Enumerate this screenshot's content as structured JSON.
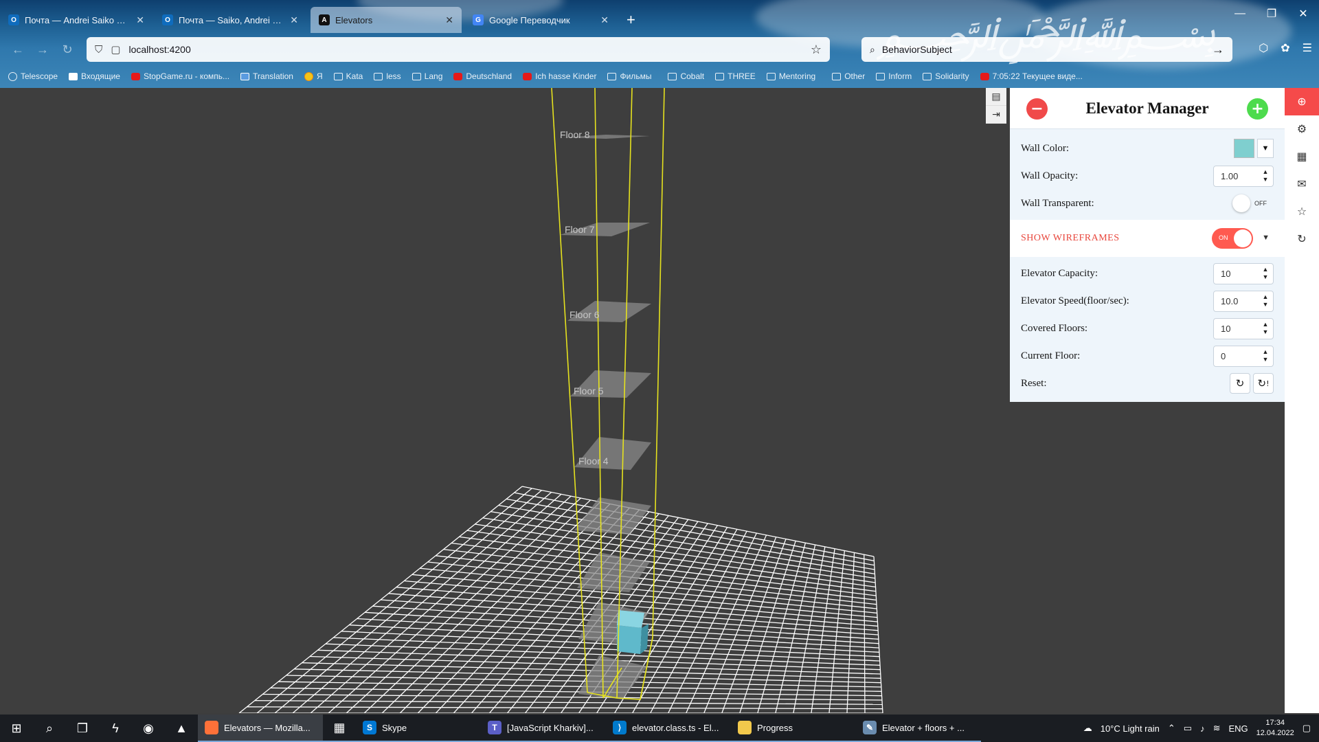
{
  "browser": {
    "tabs": [
      {
        "label": "Почта — Andrei Saiko — Outlo",
        "icon": "outlook-icon",
        "color": "#0f6cbd"
      },
      {
        "label": "Почта — Saiko, Andrei — Outlo",
        "icon": "outlook-icon",
        "color": "#0f6cbd"
      },
      {
        "label": "Elevators",
        "icon": "angular-icon",
        "color": "#111111"
      },
      {
        "label": "Google Переводчик",
        "icon": "translate-icon",
        "color": "#4285f4"
      }
    ],
    "url": "localhost:4200",
    "search": "BehaviorSubject",
    "bookmarks": [
      {
        "label": "Telescope",
        "icon": "globe"
      },
      {
        "label": "Входящие",
        "icon": "gm"
      },
      {
        "label": "StopGame.ru - компь...",
        "icon": "red"
      },
      {
        "label": "Translation",
        "icon": "tr"
      },
      {
        "label": "Я",
        "icon": "ya"
      },
      {
        "label": "Kata",
        "icon": "folder"
      },
      {
        "label": "less",
        "icon": "folder"
      },
      {
        "label": "Lang",
        "icon": "folder"
      },
      {
        "label": "Deutschland",
        "icon": "red"
      },
      {
        "label": "Ich hasse Kinder",
        "icon": "red"
      },
      {
        "label": "Фильмы",
        "icon": "folder"
      },
      {
        "label": "Cobalt",
        "icon": "folder"
      },
      {
        "label": "THREE",
        "icon": "folder"
      },
      {
        "label": "Mentoring",
        "icon": "folder"
      },
      {
        "label": "Other",
        "icon": "folder"
      },
      {
        "label": "Inform",
        "icon": "folder"
      },
      {
        "label": "Solidarity",
        "icon": "folder"
      },
      {
        "label": "7:05:22 Текущее виде...",
        "icon": "red"
      }
    ]
  },
  "scene": {
    "floor_labels": [
      "Floor 8",
      "Floor 7",
      "Floor 6",
      "Floor 5",
      "Floor 4"
    ]
  },
  "panel": {
    "title": "Elevator Manager",
    "remove_symbol": "−",
    "add_symbol": "+",
    "wall_color_label": "Wall Color:",
    "wall_color_value": "#7fcfcf",
    "wall_opacity_label": "Wall Opacity:",
    "wall_opacity_value": "1.00",
    "wall_transparent_label": "Wall Transparent:",
    "wall_transparent_state": "OFF",
    "wireframes_label": "SHOW WIREFRAMES",
    "wireframes_state": "ON",
    "capacity_label": "Elevator Capacity:",
    "capacity_value": "10",
    "speed_label": "Elevator Speed(floor/sec):",
    "speed_value": "10.0",
    "covered_label": "Covered Floors:",
    "covered_value": "10",
    "current_label": "Current Floor:",
    "current_value": "0",
    "reset_label": "Reset:",
    "reset_btn2_text": "!"
  },
  "taskbar": {
    "apps": [
      {
        "label": "Elevators — Mozilla...",
        "active": true,
        "icon_color": "#ff7139"
      },
      {
        "label": "",
        "active": false,
        "icon_color": "#1e5fa8"
      },
      {
        "label": "Skype",
        "active": false,
        "icon_color": "#0078d4"
      },
      {
        "label": "[JavaScript Kharkiv]...",
        "active": false,
        "icon_color": "#5b5fc7"
      },
      {
        "label": "elevator.class.ts - El...",
        "active": false,
        "icon_color": "#007acc"
      },
      {
        "label": "Progress",
        "active": false,
        "icon_color": "#f2c94c"
      },
      {
        "label": "Elevator + floors + ...",
        "active": false,
        "icon_color": "#6a8caf"
      }
    ],
    "weather": "10°C  Light rain",
    "lang": "ENG",
    "time": "17:34",
    "date": "12.04.2022"
  },
  "colors": {
    "wireframe": "#e6e21e",
    "grid": "#ffffff",
    "cabin": "#6fc4d4"
  }
}
